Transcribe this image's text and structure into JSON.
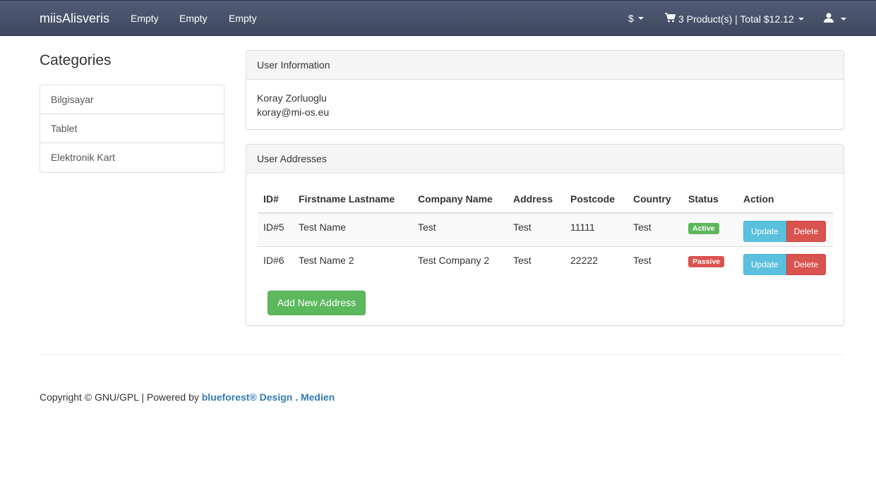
{
  "navbar": {
    "brand": "miisAlisveris",
    "links": [
      "Empty",
      "Empty",
      "Empty"
    ],
    "currency": "$",
    "cart": "3 Product(s) | Total $12.12"
  },
  "sidebar": {
    "title": "Categories",
    "items": [
      "Bilgisayar",
      "Tablet",
      "Elektronik Kart"
    ]
  },
  "user_info": {
    "heading": "User Information",
    "name": "Koray Zorluoglu",
    "email": "koray@mi-os.eu"
  },
  "addresses": {
    "heading": "User Addresses",
    "columns": [
      "ID#",
      "Firstname Lastname",
      "Company Name",
      "Address",
      "Postcode",
      "Country",
      "Status",
      "Action"
    ],
    "rows": [
      {
        "id": "ID#5",
        "name": "Test Name",
        "company": "Test",
        "address": "Test",
        "postcode": "11111",
        "country": "Test",
        "status": "Active"
      },
      {
        "id": "ID#6",
        "name": "Test Name 2",
        "company": "Test Company 2",
        "address": "Test",
        "postcode": "22222",
        "country": "Test",
        "status": "Passive"
      }
    ],
    "update_label": "Update",
    "delete_label": "Delete",
    "add_label": "Add New Address"
  },
  "footer": {
    "text": "Copyright © GNU/GPL | Powered by",
    "link": "blueforest® Design . Medien"
  },
  "colors": {
    "active": "#5cb85c",
    "passive": "#d9534f",
    "link": "#337ab7"
  }
}
